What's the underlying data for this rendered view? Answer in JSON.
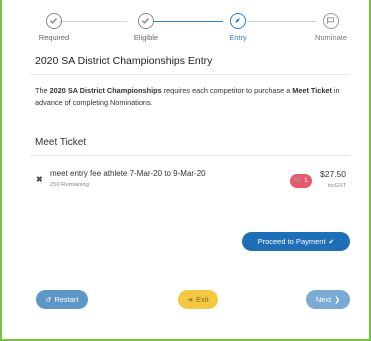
{
  "stepper": {
    "steps": [
      {
        "label": "Required",
        "state": "done"
      },
      {
        "label": "Eligible",
        "state": "done"
      },
      {
        "label": "Entry",
        "state": "active"
      },
      {
        "label": "Nominate",
        "state": "pending"
      }
    ]
  },
  "entry": {
    "title": "2020 SA District Championships Entry",
    "desc_pre": "The ",
    "desc_bold1": "2020 SA District Championships",
    "desc_mid": " requires each competitor to purchase a ",
    "desc_bold2": "Meet Ticket",
    "desc_post": " in advance of completing Nominations."
  },
  "meet_ticket": {
    "heading": "Meet Ticket",
    "item": {
      "description": "meet entry fee athlete 7-Mar-20 to 9-Mar-20",
      "remaining": "250 Remaining",
      "cart_count": "1",
      "price": "$27.50",
      "tax_note": "incGST"
    }
  },
  "buttons": {
    "proceed": "Proceed to Payment",
    "restart": "Restart",
    "exit": "Exit",
    "next": "Next"
  },
  "colors": {
    "accent_blue": "#2f7fc2",
    "frame_green": "#7ac143",
    "badge_red": "#e85a6b",
    "exit_yellow": "#f5c842"
  }
}
